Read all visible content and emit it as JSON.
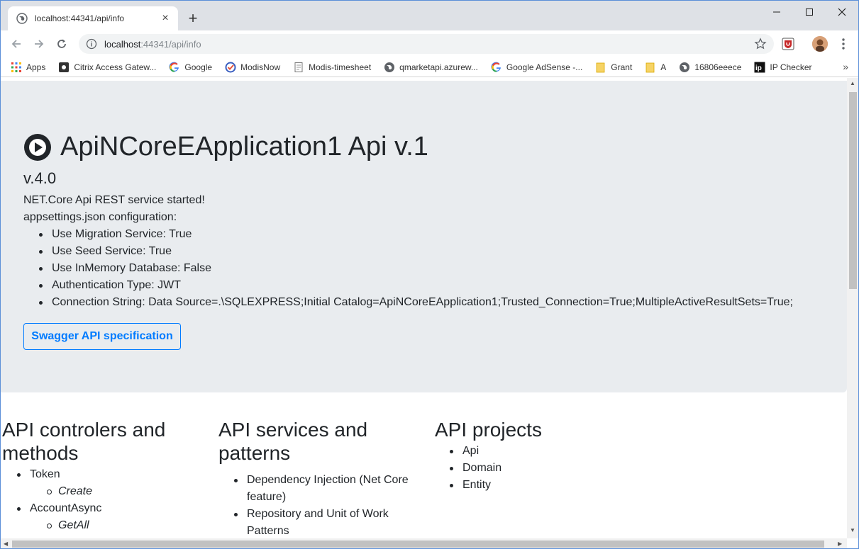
{
  "browser": {
    "tab_title": "localhost:44341/api/info",
    "new_tab_label": "+",
    "tab_close_label": "×",
    "url_host": "localhost",
    "url_rest": ":44341/api/info",
    "bookmarks": [
      {
        "label": "Apps",
        "icon": "apps-grid-icon"
      },
      {
        "label": "Citrix Access Gatew...",
        "icon": "citrix-icon"
      },
      {
        "label": "Google",
        "icon": "google-icon"
      },
      {
        "label": "ModisNow",
        "icon": "modisnow-icon"
      },
      {
        "label": "Modis-timesheet",
        "icon": "page-icon"
      },
      {
        "label": "qmarketapi.azurew...",
        "icon": "globe-icon"
      },
      {
        "label": "Google AdSense -...",
        "icon": "google-icon"
      },
      {
        "label": "Grant",
        "icon": "folder-icon"
      },
      {
        "label": "A",
        "icon": "folder-icon"
      },
      {
        "label": "16806eeece",
        "icon": "globe-icon"
      },
      {
        "label": "IP Checker",
        "icon": "ip-icon"
      }
    ],
    "bookmarks_more": "»"
  },
  "page": {
    "title": "ApiNCoreEApplication1 Api v.1",
    "version": "v.4.0",
    "started": "NET.Core Api REST service started!",
    "config_heading": "appsettings.json configuration:",
    "config_items": [
      "Use Migration Service: True",
      "Use Seed Service: True",
      "Use InMemory Database: False",
      "Authentication Type: JWT",
      "Connection String: Data Source=.\\SQLEXPRESS;Initial Catalog=ApiNCoreEApplication1;Trusted_Connection=True;MultipleActiveResultSets=True;"
    ],
    "swagger_label": "Swagger API specification",
    "columns": {
      "controllers": {
        "title_line1": "API controlers and",
        "title_line2": "methods",
        "items": [
          "Token",
          "Create",
          "AccountAsync",
          "GetAll"
        ]
      },
      "services": {
        "title_line1": "API services and",
        "title_line2": "patterns",
        "items": [
          {
            "line1": "Dependency Injection (Net Core",
            "line2": "feature)"
          },
          {
            "line1": "Repository and Unit of Work",
            "line2": "Patterns"
          }
        ]
      },
      "projects": {
        "title": "API projects",
        "items": [
          "Api",
          "Domain",
          "Entity"
        ]
      }
    }
  },
  "colors": {
    "jumbotron_bg": "#e9ecef",
    "primary": "#007bff",
    "tabstrip_bg": "#dee1e6"
  }
}
